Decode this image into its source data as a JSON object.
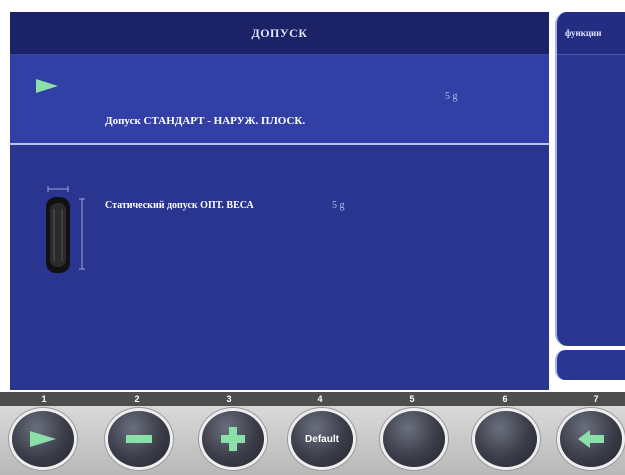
{
  "header": {
    "title": "ДОПУСК"
  },
  "option": {
    "label": "Допуск СТАНДАРТ - НАРУЖ. ПЛОСК.",
    "value": "5 g"
  },
  "detail": {
    "label": "Статический допуск ОПТ. ВЕСА",
    "value": "5 g"
  },
  "side_panel": {
    "title": "функции"
  },
  "function_keys": [
    "1",
    "2",
    "3",
    "4",
    "5",
    "6",
    "7"
  ],
  "buttons": {
    "b1": {
      "icon": "play-icon"
    },
    "b2": {
      "icon": "minus-icon"
    },
    "b3": {
      "icon": "plus-icon"
    },
    "b4": {
      "label": "Default"
    },
    "b5": {
      "icon": "blank"
    },
    "b6": {
      "icon": "blank"
    },
    "b7": {
      "icon": "back-arrow-icon"
    }
  },
  "colors": {
    "panel_blue": "#2a3590",
    "title_blue": "#1b2266",
    "accent_green": "#8ae0a8",
    "value_blue": "#9fc7f0"
  }
}
